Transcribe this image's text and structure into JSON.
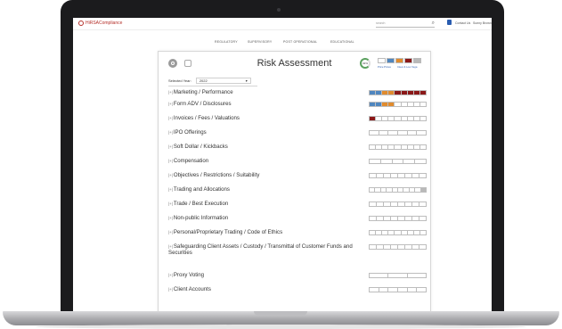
{
  "header": {
    "logo_text": "HiRSACompliance",
    "search_placeholder": "search",
    "top_links": [
      "Contact Us",
      "Sunny Brown"
    ]
  },
  "nav": [
    "REGULATORY",
    "SUPERVISORY",
    "POST OPERATIONAL",
    "EDUCATIONAL"
  ],
  "panel": {
    "title": "Risk Assessment",
    "percent": "32%",
    "legend_captions": [
      "Price Prices",
      "Clear & Low Vega"
    ],
    "year_label": "Selected Year:",
    "year_value": "2022"
  },
  "colors": {
    "blue": "#4f86bf",
    "orange": "#e08b2e",
    "red": "#8b1818",
    "grey": "#b9b9b9",
    "empty": "#ffffff"
  },
  "rows": [
    {
      "label": "Marketing / Performance",
      "segments": [
        "blue",
        "blue",
        "orange",
        "orange",
        "red",
        "red",
        "red",
        "red",
        "red"
      ]
    },
    {
      "label": "Form ADV / Disclosures",
      "segments": [
        "blue",
        "blue",
        "orange",
        "orange",
        "empty",
        "empty",
        "empty",
        "empty",
        "empty"
      ]
    },
    {
      "label": "Invoices / Fees / Valuations",
      "segments": [
        "red",
        "empty",
        "empty",
        "empty",
        "empty",
        "empty",
        "empty",
        "empty",
        "empty"
      ]
    },
    {
      "label": "IPO Offerings",
      "segments": [
        "empty",
        "empty",
        "empty",
        "empty",
        "empty",
        "empty"
      ]
    },
    {
      "label": "Soft Dollar / Kickbacks",
      "segments": [
        "empty",
        "empty",
        "empty",
        "empty",
        "empty",
        "empty",
        "empty",
        "empty",
        "empty"
      ]
    },
    {
      "label": "Compensation",
      "segments": [
        "empty",
        "empty",
        "empty",
        "empty",
        "empty"
      ]
    },
    {
      "label": "Objectives / Restrictions / Suitability",
      "segments": [
        "empty",
        "empty",
        "empty",
        "empty",
        "empty",
        "empty",
        "empty",
        "empty"
      ]
    },
    {
      "label": "Trading and Allocations",
      "segments": [
        "empty",
        "empty",
        "empty",
        "empty",
        "empty",
        "empty",
        "empty",
        "empty",
        "empty",
        "grey"
      ]
    },
    {
      "label": "Trade / Best Execution",
      "segments": [
        "empty",
        "empty",
        "empty",
        "empty",
        "empty",
        "empty",
        "empty",
        "empty"
      ]
    },
    {
      "label": "Non-public Information",
      "segments": [
        "empty",
        "empty",
        "empty",
        "empty",
        "empty",
        "empty",
        "empty",
        "empty"
      ]
    },
    {
      "label": "Personal/Proprietary Trading / Code of Ethics",
      "segments": [
        "empty",
        "empty",
        "empty",
        "empty",
        "empty",
        "empty",
        "empty",
        "empty",
        "empty"
      ]
    },
    {
      "label": "Safeguarding Client Assets / Custody / Transmittal of Customer Funds and Securities",
      "segments": [
        "empty",
        "empty",
        "empty",
        "empty",
        "empty",
        "empty",
        "empty",
        "empty"
      ]
    },
    {
      "label": "Proxy Voting",
      "segments": [
        "empty",
        "empty",
        "empty"
      ]
    },
    {
      "label": "Client Accounts",
      "segments": [
        "empty",
        "empty",
        "empty",
        "empty",
        "empty",
        "empty"
      ]
    }
  ]
}
